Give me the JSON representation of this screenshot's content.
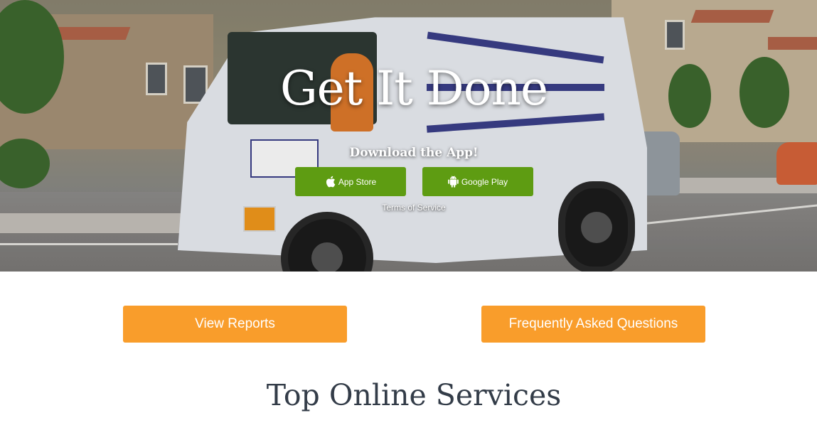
{
  "hero": {
    "title": "Get It Done",
    "subtitle": "Download the App!",
    "app_store_label": "App Store",
    "google_play_label": "Google Play",
    "terms_label": "Terms of Service",
    "background_image": "street-sweeper-truck",
    "button_color": "#5e9c12"
  },
  "actions": {
    "view_reports_label": "View Reports",
    "faq_label": "Frequently Asked Questions",
    "button_color": "#f99d2b"
  },
  "section": {
    "title": "Top Online Services"
  },
  "icons": {
    "app_store": "apple-icon",
    "google_play": "android-icon"
  }
}
